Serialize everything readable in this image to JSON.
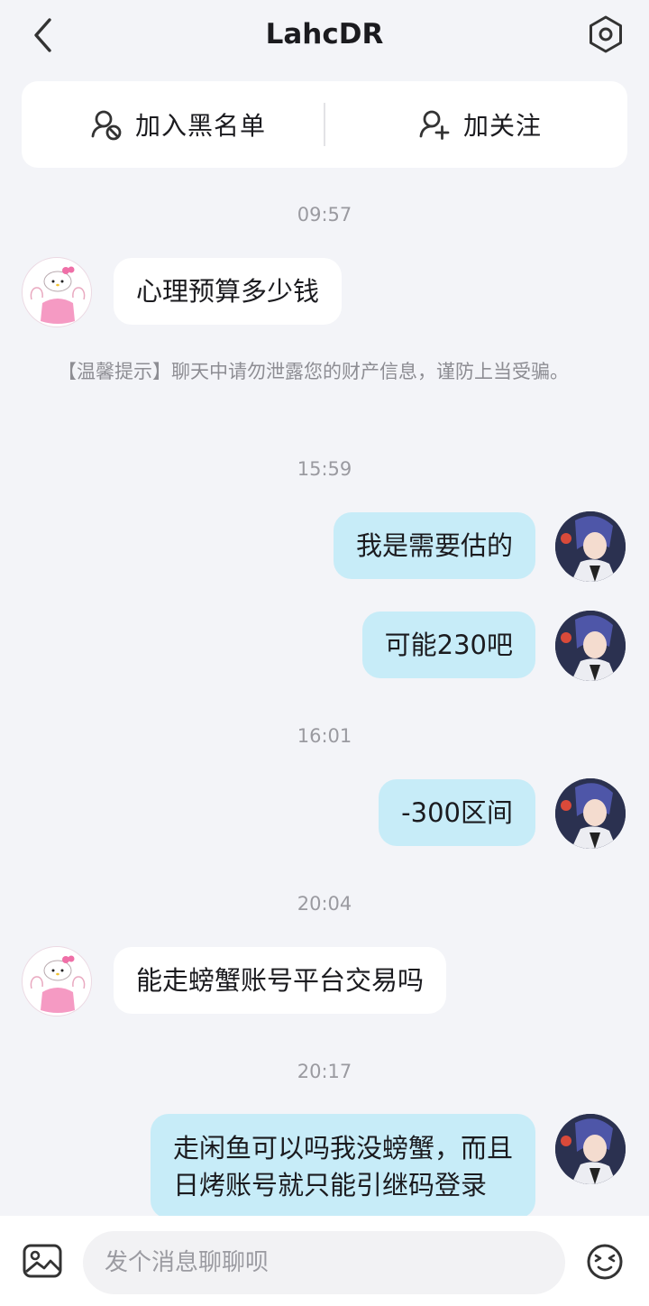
{
  "header": {
    "title": "LahcDR",
    "back_icon": "chevron-left-icon",
    "settings_icon": "settings-hexagon-icon"
  },
  "actions": {
    "blacklist_label": "加入黑名单",
    "blacklist_icon": "user-block-icon",
    "follow_label": "加关注",
    "follow_icon": "user-add-icon"
  },
  "chat": {
    "timestamps": [
      "09:57",
      "15:59",
      "16:01",
      "20:04",
      "20:17"
    ],
    "tip": "【温馨提示】聊天中请勿泄露您的财产信息，谨防上当受骗。",
    "messages": [
      {
        "direction": "in",
        "text": "心理预算多少钱"
      },
      {
        "direction": "out",
        "text": "我是需要估的"
      },
      {
        "direction": "out",
        "text": "可能230吧"
      },
      {
        "direction": "out",
        "text": "-300区间"
      },
      {
        "direction": "in",
        "text": "能走螃蟹账号平台交易吗"
      },
      {
        "direction": "out",
        "line1": "走闲鱼可以吗我没螃蟹，而且",
        "line2": "日烤账号就只能引继码登录"
      }
    ]
  },
  "input": {
    "placeholder": "发个消息聊聊呗",
    "value": "",
    "image_icon": "image-icon",
    "emoji_icon": "emoji-face-icon"
  },
  "colors": {
    "background": "#f3f4f8",
    "outgoing_bubble": "#c7ecf8",
    "incoming_bubble": "#ffffff",
    "muted_text": "#9a9aa0"
  }
}
